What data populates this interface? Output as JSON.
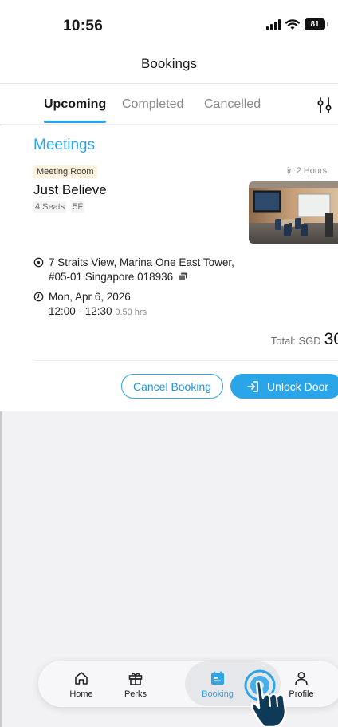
{
  "status_bar": {
    "time": "10:56",
    "battery": "81"
  },
  "header": {
    "title": "Bookings"
  },
  "tabs": [
    {
      "label": "Upcoming",
      "active": true
    },
    {
      "label": "Completed",
      "active": false
    },
    {
      "label": "Cancelled",
      "active": false
    }
  ],
  "filter_icon": "filter-sliders-icon",
  "section": {
    "title": "Meetings"
  },
  "booking": {
    "badge": "Meeting Room",
    "time_until": "in 2 Hours",
    "room_name": "Just Believe",
    "seats": "4 Seats",
    "floor": "5F",
    "address_line1": "7 Straits View, Marina One East Tower,",
    "address_line2": "#05-01 Singapore 018936",
    "date": "Mon, Apr 6, 2026",
    "time_range": "12:00 - 12:30",
    "duration": "0.50 hrs",
    "total_label": "Total: SGD",
    "total_amount": "30"
  },
  "actions": {
    "cancel_label": "Cancel Booking",
    "unlock_label": "Unlock Door"
  },
  "nav": [
    {
      "label": "Home",
      "icon": "home-icon"
    },
    {
      "label": "Perks",
      "icon": "gift-icon"
    },
    {
      "label": "Booking",
      "icon": "calendar-icon",
      "active": true
    },
    {
      "label": "Profile",
      "icon": "person-icon"
    }
  ],
  "colors": {
    "accent": "#2aa6e8",
    "badge_bg": "#fbf1dc"
  }
}
